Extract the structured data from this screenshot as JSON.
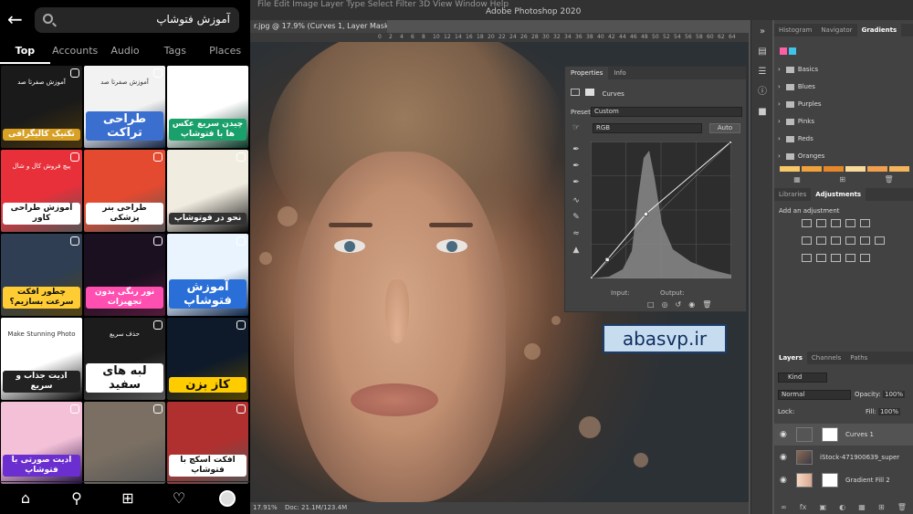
{
  "phone": {
    "search_query": "آموزش فتوشاپ",
    "tabs": [
      "Top",
      "Accounts",
      "Audio",
      "Tags",
      "Places"
    ],
    "tiles": [
      {
        "label": "تکنیک کالیگرافی",
        "bg": "#1a1a1a",
        "accent": "#d9a026"
      },
      {
        "label": "طراحی تراکت",
        "bg": "#f2f2f2",
        "accent": "#3a6fd0"
      },
      {
        "label": "چیدن سریع عکس ها با فتوشاپ",
        "bg": "#ffffff",
        "accent": "#1aa06a"
      },
      {
        "label": "آموزش طراحی کاور",
        "bg": "#e8303a",
        "accent": "#ffffff"
      },
      {
        "label": "طراحی بنر پزشکی",
        "bg": "#e34a30",
        "accent": "#ffffff"
      },
      {
        "label": "نحو در فوتوشاپ",
        "bg": "#f1ece0",
        "accent": "#333333"
      },
      {
        "label": "چطور افکت سرعت بسازیم؟",
        "bg": "#2f3e52",
        "accent": "#ffcc33"
      },
      {
        "label": "نور رنگی بدون تجهیزات",
        "bg": "#1a1020",
        "accent": "#ff4fb0"
      },
      {
        "label": "آموزش فتوشاپ",
        "bg": "#eaf4ff",
        "accent": "#2a6fd8"
      },
      {
        "label": "ادیت جذاب و سریع",
        "bg": "#ffffff",
        "accent": "#222222"
      },
      {
        "label": "لبه های سفید",
        "bg": "#1c1c1c",
        "accent": "#ffffff"
      },
      {
        "label": "کاز بزن",
        "bg": "#0e1a2a",
        "accent": "#ffcc00"
      },
      {
        "label": "ادیت صورتی با فتوشاپ",
        "bg": "#f4c0d8",
        "accent": "#6b2fd0"
      },
      {
        "label": "",
        "bg": "#7a6f62",
        "accent": "#ffffff"
      },
      {
        "label": "افکت اسکچ با فتوشاپ",
        "bg": "#b03030",
        "accent": "#ffffff"
      }
    ],
    "tile_texts": {
      "t0": "آموزش صفرتا صد",
      "t1": "آموزش صفرتا صد",
      "t3": "پیچ فروش کال و شال",
      "t9": "Make Stunning Photo",
      "t10": "حذف سریع"
    },
    "nav_icons": [
      "home-icon",
      "search-icon",
      "add-icon",
      "heart-icon",
      "profile-avatar"
    ]
  },
  "photoshop": {
    "menu": "File  Edit  Image  Layer  Type  Select  Filter  3D  View  Window  Help",
    "app_title": "Adobe Photoshop 2020",
    "doc_tab": "r.jpg @ 17.9% (Curves 1, Layer Mask/8) *",
    "ruler_ticks": [
      "0",
      "2",
      "4",
      "6",
      "8",
      "10",
      "12",
      "14",
      "16",
      "18",
      "20",
      "22",
      "24",
      "26",
      "28",
      "30",
      "32",
      "34",
      "36",
      "38",
      "40",
      "42",
      "44",
      "46",
      "48",
      "50",
      "52",
      "54",
      "56",
      "58",
      "60",
      "62",
      "64"
    ],
    "status": "17.91%",
    "status_size": "Doc: 21.1M/123.4M",
    "properties": {
      "tabs": [
        "Properties",
        "Info"
      ],
      "layer_type": "Curves",
      "preset_label": "Preset:",
      "preset_value": "Custom",
      "channel": "RGB",
      "auto": "Auto",
      "input_label": "Input:",
      "output_label": "Output:"
    },
    "watermark": "abasvp.ir",
    "gradients": {
      "tabs": [
        "Histogram",
        "Navigator",
        "Gradients"
      ],
      "swatch_colors": [
        "#ff5ea8",
        "#3fc3e8"
      ],
      "folders": [
        "Basics",
        "Blues",
        "Purples",
        "Pinks",
        "Reds",
        "Oranges"
      ],
      "orange_colors": [
        "#f6c86a",
        "#f2a23c",
        "#e6872b",
        "#f8d999",
        "#ef9f4e",
        "#f4b45c"
      ]
    },
    "adjustments": {
      "tabs": [
        "Libraries",
        "Adjustments"
      ],
      "hint": "Add an adjustment"
    },
    "layers": {
      "tabs": [
        "Layers",
        "Channels",
        "Paths"
      ],
      "kind": "Kind",
      "blend": "Normal",
      "opacity_label": "Opacity:",
      "opacity": "100%",
      "lock_label": "Lock:",
      "fill_label": "Fill:",
      "fill": "100%",
      "items": [
        {
          "name": "Curves 1",
          "selected": true
        },
        {
          "name": "iStock-471900639_super",
          "selected": false
        },
        {
          "name": "Gradient Fill 2",
          "selected": false
        }
      ]
    }
  },
  "chart_data": {
    "type": "line",
    "x": [
      0,
      30,
      100,
      255
    ],
    "y": [
      0,
      35,
      120,
      255
    ],
    "xlim": [
      0,
      255
    ],
    "ylim": [
      0,
      255
    ]
  }
}
